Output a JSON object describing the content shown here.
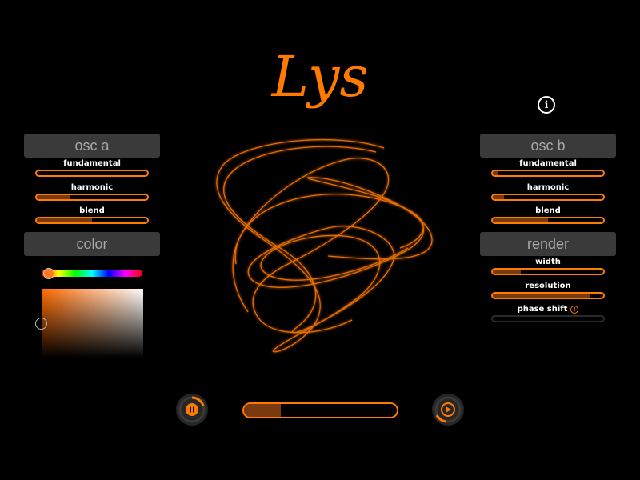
{
  "app": {
    "title": "Lys"
  },
  "colors": {
    "accent": "#ff7a00",
    "slider_fill": "#7a3a10",
    "header_bg": "#3a3a3a"
  },
  "osc_a": {
    "header": "osc a",
    "controls": [
      {
        "label": "fundamental",
        "value": 0.0
      },
      {
        "label": "harmonic",
        "value": 0.3
      },
      {
        "label": "blend",
        "value": 0.5
      }
    ]
  },
  "color": {
    "header": "color",
    "hue_value": 0.06
  },
  "osc_b": {
    "header": "osc b",
    "controls": [
      {
        "label": "fundamental",
        "value": 0.05
      },
      {
        "label": "harmonic",
        "value": 0.1
      },
      {
        "label": "blend",
        "value": 0.5
      }
    ]
  },
  "render": {
    "header": "render",
    "controls": [
      {
        "label": "width",
        "value": 0.25
      },
      {
        "label": "resolution",
        "value": 0.88
      },
      {
        "label": "phase shift",
        "value": 0.0,
        "icon": "warning-icon",
        "disabled": true
      }
    ]
  },
  "info": {
    "icon": "info-icon",
    "label": "i"
  },
  "transport": {
    "pause_icon": "pause-icon",
    "play_icon": "play-icon",
    "progress": 0.24
  }
}
